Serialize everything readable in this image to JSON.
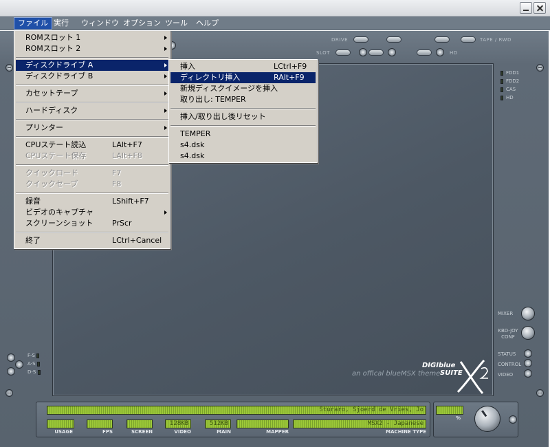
{
  "menubar": {
    "items": [
      {
        "label": "ファイル"
      },
      {
        "label": "実行"
      },
      {
        "label": "ウィンドウ"
      },
      {
        "label": "オプション"
      },
      {
        "label": "ツール"
      },
      {
        "label": "ヘルプ"
      }
    ]
  },
  "file_menu": {
    "items": [
      {
        "label": "ROMスロット 1",
        "submenu": true
      },
      {
        "label": "ROMスロット 2",
        "submenu": true
      },
      {
        "label": "ディスクドライブ A",
        "submenu": true,
        "highlighted": true
      },
      {
        "label": "ディスクドライブ B",
        "submenu": true
      },
      {
        "label": "カセットテープ",
        "submenu": true
      },
      {
        "label": "ハードディスク",
        "submenu": true
      },
      {
        "label": "プリンター",
        "submenu": true
      },
      {
        "label": "CPUステート読込",
        "shortcut": "LAlt+F7"
      },
      {
        "label": "CPUステート保存",
        "shortcut": "LAlt+F8",
        "disabled": true
      },
      {
        "label": "クイックロード",
        "shortcut": "F7",
        "disabled": true
      },
      {
        "label": "クイックセーブ",
        "shortcut": "F8",
        "disabled": true
      },
      {
        "label": "録音",
        "shortcut": "LShift+F7"
      },
      {
        "label": "ビデオのキャプチャ",
        "submenu": true
      },
      {
        "label": "スクリーンショット",
        "shortcut": "PrScr"
      },
      {
        "label": "終了",
        "shortcut": "LCtrl+Cancel"
      }
    ]
  },
  "disk_a_menu": {
    "items": [
      {
        "label": "挿入",
        "shortcut": "LCtrl+F9"
      },
      {
        "label": "ディレクトリ挿入",
        "shortcut": "RAlt+F9",
        "highlighted": true
      },
      {
        "label": "新規ディスクイメージを挿入"
      },
      {
        "label": "取り出し: TEMPER"
      },
      {
        "label": "挿入/取り出し後リセット"
      },
      {
        "label": "TEMPER"
      },
      {
        "label": "s4.dsk"
      },
      {
        "label": "s4.dsk"
      }
    ]
  },
  "skin": {
    "top_labels": {
      "drive": "DRIVE",
      "slot": "SLOT",
      "tape": "TAPE / RWD",
      "hd": "HD"
    },
    "leds_right": [
      "FDD1",
      "FDD2",
      "CAS",
      "HD"
    ],
    "leds_left": [
      "F-S",
      "A-S",
      "D-S"
    ],
    "controls_right": [
      "MIXER",
      "KBD-JOY CONF",
      "STATUS",
      "CONTROL",
      "VIDEO"
    ],
    "logo": {
      "line1": "DIGIblue",
      "line2": "SUITE",
      "tagline": "an offical blueMSX theme"
    }
  },
  "status": {
    "ticker": "Sturaro,  Sjoerd de Vries,  Jo",
    "machine_type_value": "MSX2 - Japanese",
    "video_value": "128KB",
    "main_value": "512KB",
    "labels": {
      "usage": "USAGE",
      "fps": "FPS",
      "screen": "SCREEN",
      "video": "VIDEO",
      "main": "MAIN",
      "mapper": "MAPPER",
      "machine_type": "MACHINE TYPE",
      "percent": "%"
    }
  },
  "colors": {
    "highlight": "#0a246a",
    "menu_bg": "#d4d0c8",
    "lcd": "#9cc838",
    "skin": "#5f6a76"
  }
}
